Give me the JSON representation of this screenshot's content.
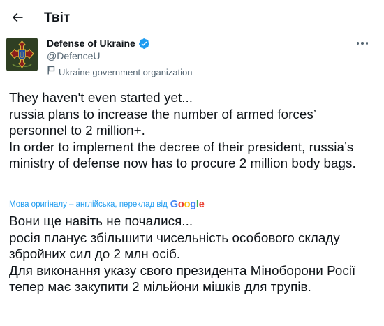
{
  "header": {
    "back_icon": "arrow-left-icon",
    "title": "Твіт"
  },
  "author": {
    "avatar_icon": "ukraine-defense-emblem",
    "name": "Defense of Ukraine",
    "verified_icon": "verified-badge-icon",
    "handle": "@DefenceU",
    "label_icon": "flag-icon",
    "label": "Ukraine government organization"
  },
  "more_icon": "more-horizontal-icon",
  "tweet": {
    "text": "They haven't even started yet...\nrussia plans to increase the number of armed forces’ personnel to 2 million+.\nIn order to implement the decree of their president, russia’s ministry of defense now has to procure 2 million body bags."
  },
  "translation": {
    "note": "Мова оригіналу – англійська, переклад від",
    "provider": "Google",
    "text": "Вони ще навіть не почалися...\nросія планує збільшити чисельність особового складу збройних сил до 2 млн осіб.\nДля виконання указу свого президента Міноборони Росії тепер має закупити 2 мільйони мішків для трупів."
  },
  "colors": {
    "text": "#0f1419",
    "secondary": "#536471",
    "link": "#1d9bf0",
    "avatar_bg": "#2f3f23",
    "emblem_gold": "#d9b23a",
    "emblem_red": "#8a1c1c"
  }
}
